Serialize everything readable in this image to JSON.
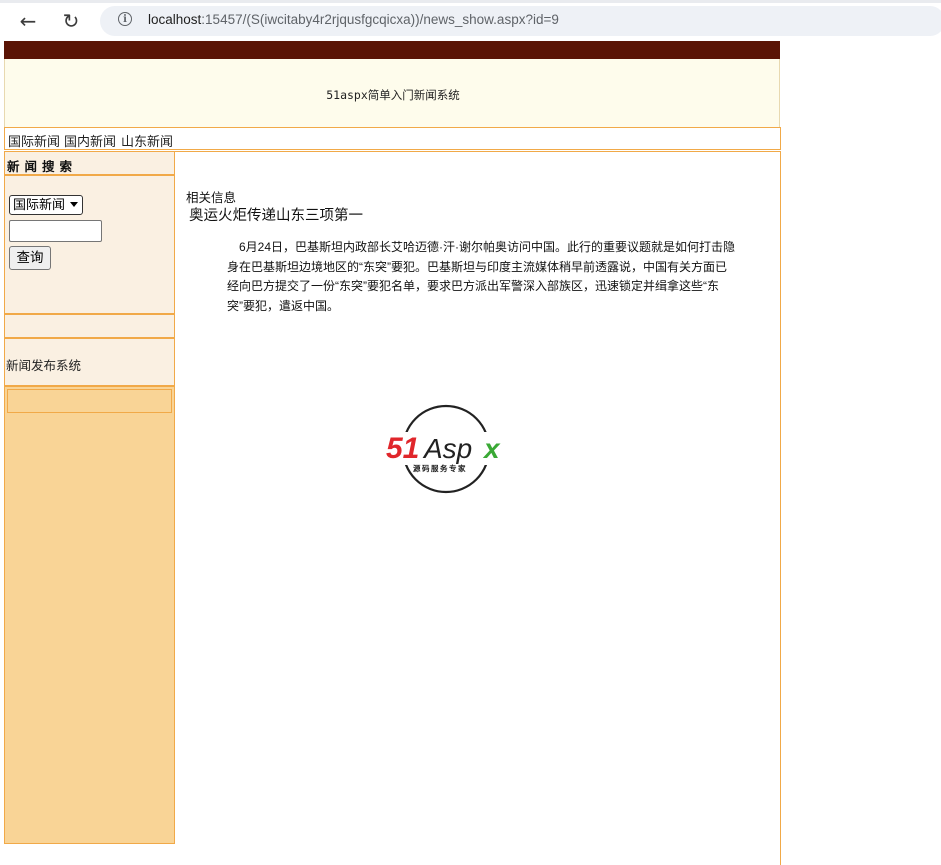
{
  "browser": {
    "url_host": "localhost",
    "url_rest": ":15457/(S(iwcitaby4r2rjqusfgcqicxa))/news_show.aspx?id=9"
  },
  "header": {
    "site_title": "51aspx简单入门新闻系统"
  },
  "menu": {
    "items": [
      "国际新闻",
      "国内新闻",
      "山东新闻"
    ]
  },
  "sidebar": {
    "search_title": "新闻搜索",
    "category_selected": "国际新闻",
    "search_input_value": "",
    "search_button_label": "查询",
    "system_label": "新闻发布系统"
  },
  "content": {
    "related_label": "相关信息",
    "title": "奥运火炬传递山东三项第一",
    "body": "6月24日，巴基斯坦内政部长艾哈迈德·汗·谢尔帕奥访问中国。此行的重要议题就是如何打击隐身在巴基斯坦边境地区的“东突”要犯。巴基斯坦与印度主流媒体稍早前透露说，中国有关方面已经向巴方提交了一份“东突”要犯名单，要求巴方派出军警深入部族区，迅速锁定并缉拿这些“东突”要犯，遣返中国。"
  },
  "logo": {
    "brand_red": "51",
    "brand_black": "Asp",
    "brand_green": "x",
    "tagline": "源码服务专家",
    "colors": {
      "red": "#e0262b",
      "black": "#222222",
      "green": "#3aa935"
    }
  }
}
